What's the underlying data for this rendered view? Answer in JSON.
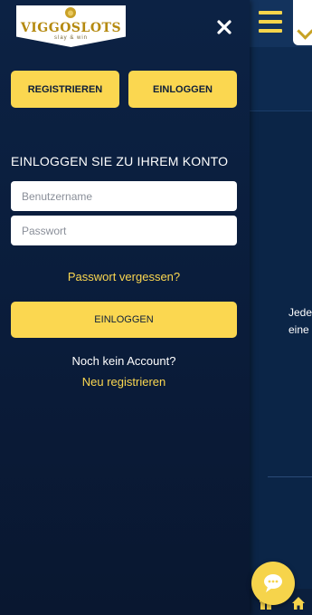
{
  "brand": {
    "logo_text": "VIGGOSLOTS",
    "logo_tagline": "slay & win",
    "accent_color": "#fbd750",
    "drawer_color": "#0c2244"
  },
  "drawer": {
    "register_label": "REGISTRIEREN",
    "login_top_label": "EINLOGGEN",
    "heading": "EINLOGGEN SIE ZU IHREM KONTO",
    "username_placeholder": "Benutzername",
    "password_placeholder": "Passwort",
    "forgot_password": "Passwort vergessen?",
    "login_button_label": "EINLOGGEN",
    "no_account_text": "Noch kein Account?",
    "new_register_link": "Neu registrieren"
  },
  "background": {
    "text_line_1": "Jede",
    "text_line_2": "eine"
  },
  "icons": {
    "close": "close-icon",
    "menu": "hamburger-menu-icon",
    "chat": "chat-icon",
    "gift": "gift-icon",
    "home": "home-icon"
  }
}
